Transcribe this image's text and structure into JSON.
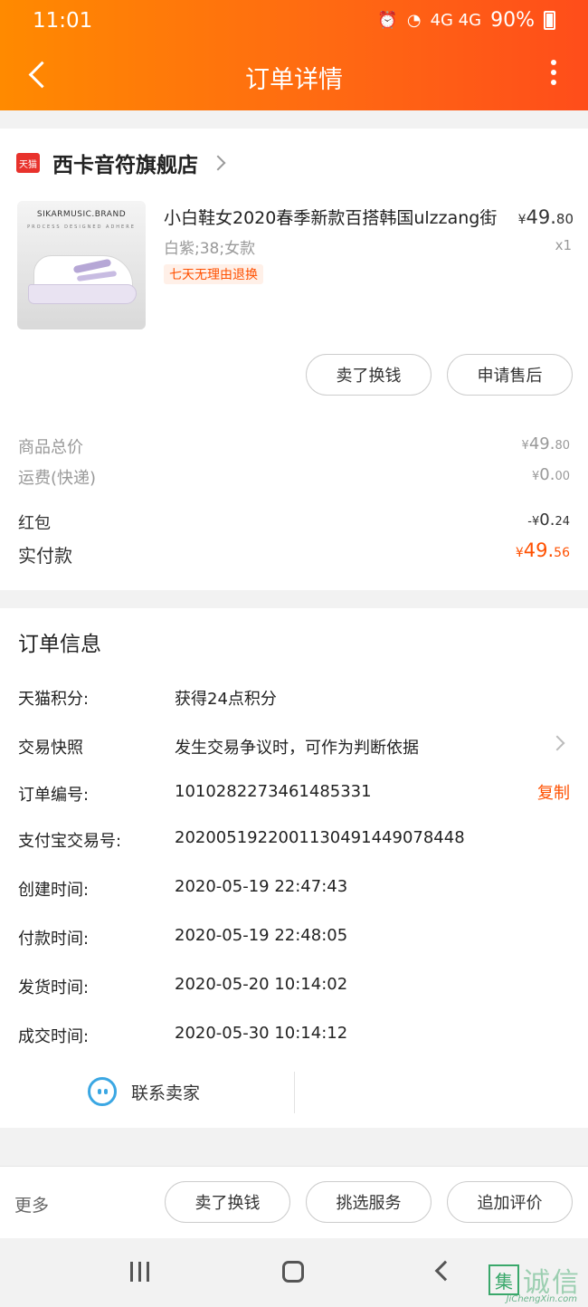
{
  "status_bar": {
    "time": "11:01",
    "signal_text": "4G 4G",
    "battery": "90%"
  },
  "nav": {
    "title": "订单详情"
  },
  "store": {
    "badge": "天猫",
    "name": "西卡音符旗舰店"
  },
  "product": {
    "image_brand": "SIKARMUSIC.BRAND",
    "image_sub": "PROCESS   DESIGNED   ADHERE",
    "title": "小白鞋女2020春季新款百搭韩国ulzzang街",
    "sku": "白紫;38;女款",
    "tag": "七天无理由退换",
    "price_symbol": "¥",
    "price_int": "49.",
    "price_dec": "80",
    "qty": "x1",
    "actions": [
      "卖了换钱",
      "申请售后"
    ]
  },
  "fees": {
    "goods_total_label": "商品总价",
    "goods_total_sym": "¥",
    "goods_total_int": "49.",
    "goods_total_dec": "80",
    "shipping_label": "运费(快递)",
    "shipping_sym": "¥",
    "shipping_int": "0.",
    "shipping_dec": "00",
    "redpacket_label": "红包",
    "redpacket_sym": "-¥",
    "redpacket_int": "0.",
    "redpacket_dec": "24",
    "paid_label": "实付款",
    "paid_sym": "¥",
    "paid_int": "49.",
    "paid_dec": "56"
  },
  "order_info": {
    "title": "订单信息",
    "rows": [
      {
        "label": "天猫积分:",
        "value": "获得24点积分"
      },
      {
        "label": "交易快照",
        "value": "发生交易争议时，可作为判断依据"
      },
      {
        "label": "订单编号:",
        "value": "1010282273461485331"
      },
      {
        "label": "支付宝交易号:",
        "value": "2020051922001130491449078448"
      },
      {
        "label": "创建时间:",
        "value": "2020-05-19 22:47:43"
      },
      {
        "label": "付款时间:",
        "value": "2020-05-19 22:48:05"
      },
      {
        "label": "发货时间:",
        "value": "2020-05-20 10:14:02"
      },
      {
        "label": "成交时间:",
        "value": "2020-05-30 10:14:12"
      }
    ],
    "copy_label": "复制",
    "contact_label": "联系卖家"
  },
  "bottom": {
    "more_label": "更多",
    "buttons": [
      "卖了换钱",
      "挑选服务",
      "追加评价"
    ]
  },
  "watermark": {
    "mark": "集",
    "text": "诚信",
    "sub": "JiChengXin.com"
  },
  "colors": {
    "header_start": "#ff8a00",
    "header_end": "#ff4d1a",
    "accent": "#ff5000"
  }
}
